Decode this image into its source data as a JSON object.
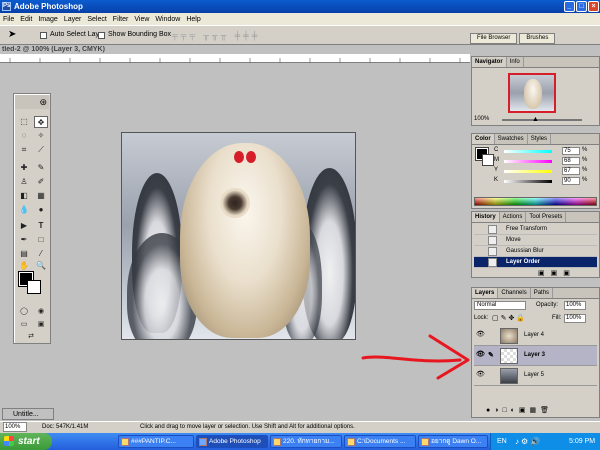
{
  "window": {
    "title": "Adobe Photoshop",
    "min": "_",
    "max": "□",
    "close": "×"
  },
  "menu": [
    "File",
    "Edit",
    "Image",
    "Layer",
    "Select",
    "Filter",
    "View",
    "Window",
    "Help"
  ],
  "options": {
    "auto_select": "Auto Select Layer",
    "show_bounding": "Show Bounding Box",
    "well_tabs": [
      "File Browser",
      "Brushes"
    ]
  },
  "document": {
    "title": "tled-2 @ 100% (Layer 3, CMYK)"
  },
  "navigator": {
    "tabs": [
      "Navigator",
      "Info"
    ],
    "zoom": "100%"
  },
  "color": {
    "tabs": [
      "Color",
      "Swatches",
      "Styles"
    ],
    "sliders": [
      {
        "label": "C",
        "value": "75"
      },
      {
        "label": "M",
        "value": "68"
      },
      {
        "label": "Y",
        "value": "67"
      },
      {
        "label": "K",
        "value": "90"
      }
    ],
    "unit": "%"
  },
  "history": {
    "tabs": [
      "History",
      "Actions",
      "Tool Presets"
    ],
    "items": [
      {
        "label": "Free Transform"
      },
      {
        "label": "Move"
      },
      {
        "label": "Gaussian Blur"
      },
      {
        "label": "Layer Order"
      }
    ]
  },
  "layers": {
    "tabs": [
      "Layers",
      "Channels",
      "Paths"
    ],
    "blend_mode": "Normal",
    "opacity_label": "Opacity:",
    "opacity": "100%",
    "lock_label": "Lock:",
    "fill_label": "Fill:",
    "fill": "100%",
    "items": [
      {
        "name": "Layer 4"
      },
      {
        "name": "Layer 3"
      },
      {
        "name": "Layer 5"
      }
    ]
  },
  "minimized_doc": "Untitle...",
  "status": {
    "zoom": "100%",
    "doc": "Doc: 547K/1.41M",
    "hint": "Click and drag to move layer or selection. Use Shift and Alt for additional options."
  },
  "taskbar": {
    "start": "start",
    "tasks": [
      "###PANTIP.C...",
      "Adobe Photoshop",
      "220. ทักทายกาม...",
      "C:\\Documents ...",
      "อยากดู Dawn O..."
    ],
    "lang": "EN",
    "clock": "5:09 PM"
  },
  "colors": {
    "accent_red": "#d61e2b",
    "title_blue": "#0a5ccf",
    "start_green": "#3c9a37"
  }
}
